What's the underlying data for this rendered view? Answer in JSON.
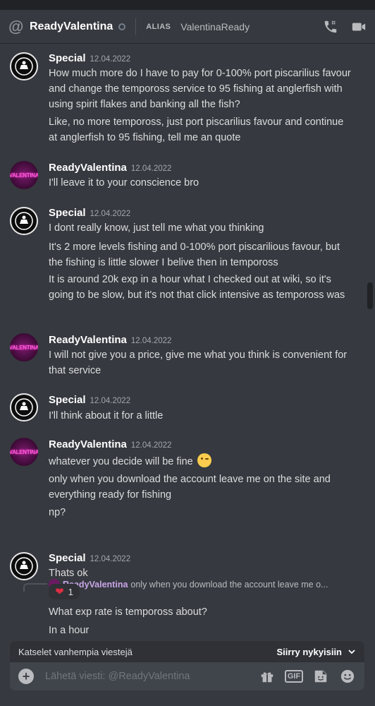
{
  "header": {
    "at_symbol": "@",
    "username": "ReadyValentina",
    "alias_label": "ALIAS",
    "alias_value": "ValentinaReady",
    "icons": [
      "call-icon",
      "video-icon"
    ]
  },
  "messages": [
    {
      "author": "Special",
      "timestamp": "12.04.2022",
      "lines": [
        "How much more do I have to pay for 0-100% port piscarilius favour and change the tempoross service to 95 fishing at anglerfish with using spirit flakes and banking all the fish?",
        "Like, no more tempoross, just port piscarilius favour and continue at anglerfish to 95 fishing, tell me an quote"
      ]
    },
    {
      "author": "ReadyValentina",
      "timestamp": "12.04.2022",
      "lines": [
        "I'll leave it to your conscience bro"
      ]
    },
    {
      "author": "Special",
      "timestamp": "12.04.2022",
      "lines": [
        "I dont really know, just tell me what you thinking",
        "It's 2 more levels fishing and 0-100% port piscarilious favour, but the fishing is little slower I belive then in tempoross",
        "It is around 20k exp in a hour what I checked out at wiki, so it's going to be slow, but it's not that click intensive as tempoross was"
      ]
    },
    {
      "author": "ReadyValentina",
      "timestamp": "12.04.2022",
      "lines": [
        "I will not give you a price, give me what you think is convenient for that service"
      ]
    },
    {
      "author": "Special",
      "timestamp": "12.04.2022",
      "lines": [
        "I'll think about it for a little"
      ]
    },
    {
      "author": "ReadyValentina",
      "timestamp": "12.04.2022",
      "lines": [
        "whatever you decide will be fine",
        "only when you download the account leave me on the site and everything ready for fishing",
        "np?"
      ]
    },
    {
      "author": "Special",
      "timestamp": "12.04.2022",
      "reply_to_author": "ReadyValentina",
      "reply_to_text": "only when you download the account leave me o...",
      "lines": [
        "Thats ok",
        "What exp rate is tempoross about?",
        "In a hour"
      ],
      "reaction": {
        "emoji": "❤",
        "count": "1"
      }
    }
  ],
  "avatar_text": "VALENTINA",
  "older_bar": {
    "text": "Katselet vanhempia viestejä",
    "jump_label": "Siirry nykyisiin"
  },
  "composer": {
    "placeholder": "Lähetä viesti: @ReadyValentina",
    "icons": [
      "gift-icon",
      "gif-icon",
      "sticker-icon",
      "emoji-icon"
    ],
    "gif_label": "GIF"
  }
}
